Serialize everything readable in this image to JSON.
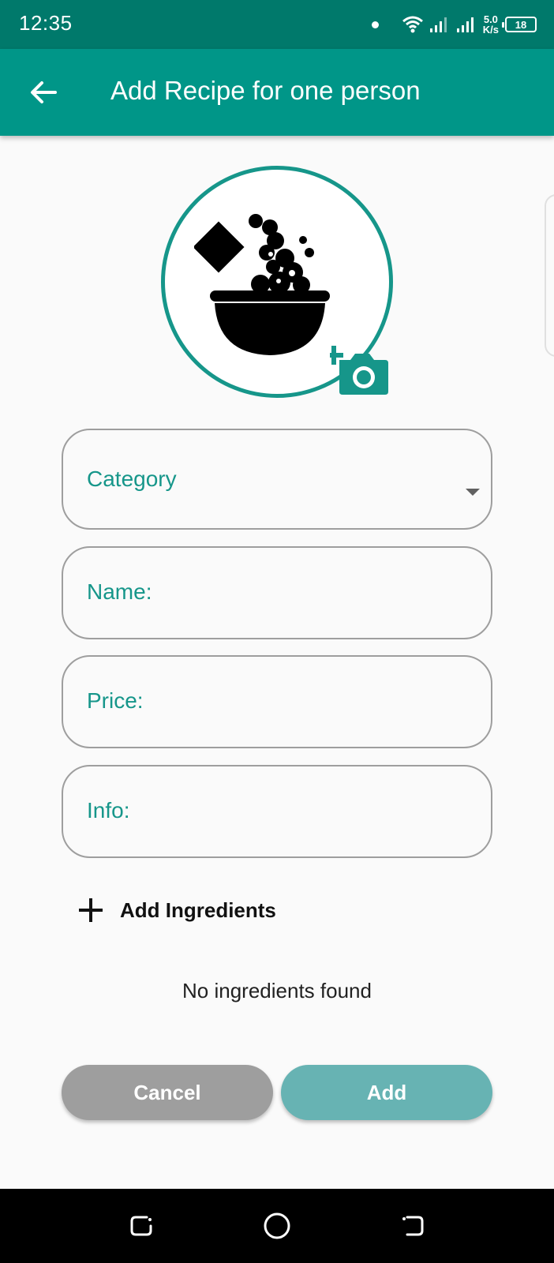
{
  "status_bar": {
    "time": "12:35",
    "speed_value": "5.0",
    "speed_unit": "K/s",
    "battery": "18"
  },
  "app_bar": {
    "title": "Add Recipe for one person"
  },
  "form": {
    "category_label": "Category",
    "name_label": "Name:",
    "price_label": "Price:",
    "info_label": "Info:"
  },
  "ingredients": {
    "add_label": "Add Ingredients",
    "empty_message": "No ingredients found"
  },
  "actions": {
    "cancel_label": "Cancel",
    "add_label": "Add"
  },
  "colors": {
    "primary": "#009688",
    "primary_dark": "#00796b",
    "accent_teal": "#16968a",
    "add_button": "#67b3b3",
    "cancel_button": "#9e9e9e"
  },
  "icons": {
    "back": "arrow-left-icon",
    "photo": "recipe-bowl-icon",
    "camera": "add-camera-icon",
    "add": "plus-icon",
    "nav_recent": "recent-apps-icon",
    "nav_home": "home-icon",
    "nav_back": "nav-back-icon"
  }
}
